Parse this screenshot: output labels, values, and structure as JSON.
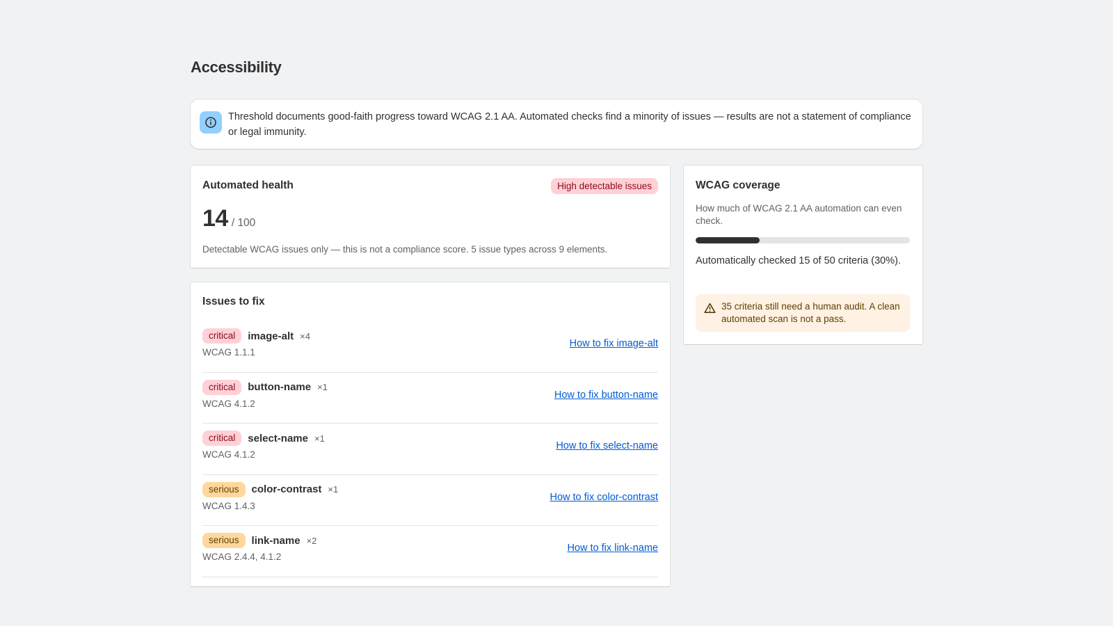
{
  "page": {
    "title": "Accessibility"
  },
  "banner": {
    "icon": "info-icon",
    "text": "Threshold documents good-faith progress toward WCAG 2.1 AA. Automated checks find a minority of issues — results are not a statement of compliance or legal immunity."
  },
  "health": {
    "title": "Automated health",
    "badge": "High detectable issues",
    "score": "14",
    "score_max": "/ 100",
    "note": "Detectable WCAG issues only — this is not a compliance score. 5 issue types across 9 elements."
  },
  "issues": {
    "title": "Issues to fix",
    "items": [
      {
        "severity": "critical",
        "rule": "image-alt",
        "count": "×4",
        "wcag": "WCAG 1.1.1",
        "link": "How to fix image-alt"
      },
      {
        "severity": "critical",
        "rule": "button-name",
        "count": "×1",
        "wcag": "WCAG 4.1.2",
        "link": "How to fix button-name"
      },
      {
        "severity": "critical",
        "rule": "select-name",
        "count": "×1",
        "wcag": "WCAG 4.1.2",
        "link": "How to fix select-name"
      },
      {
        "severity": "serious",
        "rule": "color-contrast",
        "count": "×1",
        "wcag": "WCAG 1.4.3",
        "link": "How to fix color-contrast"
      },
      {
        "severity": "serious",
        "rule": "link-name",
        "count": "×2",
        "wcag": "WCAG 2.4.4, 4.1.2",
        "link": "How to fix link-name"
      }
    ]
  },
  "coverage": {
    "title": "WCAG coverage",
    "description": "How much of WCAG 2.1 AA automation can even check.",
    "progress_percent": 30,
    "checked_text": "Automatically checked 15 of 50 criteria (30%).",
    "warning_icon": "warning-icon",
    "warning": "35 criteria still need a human audit. A clean automated scan is not a pass."
  },
  "colors": {
    "critical_bg": "#fed1d7",
    "serious_bg": "#ffd79d",
    "link": "#005bd3",
    "info_icon_bg": "#91d0ff",
    "warning_bg": "#fff1e3"
  }
}
